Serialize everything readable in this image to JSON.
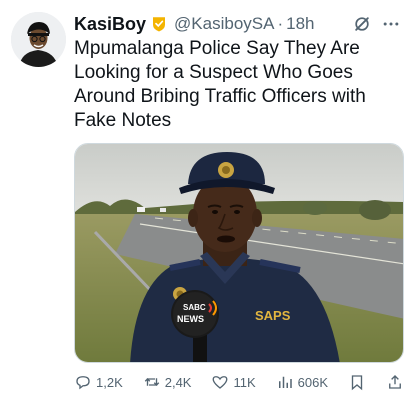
{
  "post": {
    "author_name": "KasiBoy",
    "handle": "@KasiboySA",
    "separator": "·",
    "time": "18h",
    "text": "Mpumalanga Police Say They Are Looking for a Suspect Who Goes Around Bribing Traffic Officers with Fake Notes",
    "media": {
      "badge_text": "SAPS",
      "mic_text_top": "SABC",
      "mic_text_bottom": "NEWS"
    }
  },
  "actions": {
    "replies": "1,2K",
    "reposts": "2,4K",
    "likes": "11K",
    "views": "606K"
  },
  "colors": {
    "text": "#0f1419",
    "secondary": "#536471",
    "verified": "#f4b400",
    "uniform": "#1f2b44"
  }
}
